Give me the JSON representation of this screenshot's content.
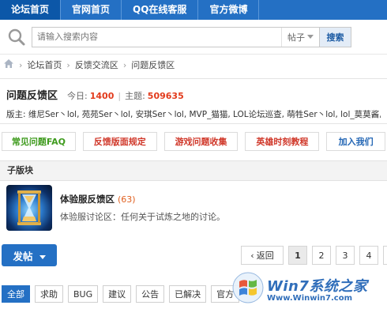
{
  "topnav": {
    "items": [
      "论坛首页",
      "官网首页",
      "QQ在线客服",
      "官方微博"
    ]
  },
  "search": {
    "placeholder": "请输入搜索内容",
    "scope": "帖子",
    "button": "搜索"
  },
  "breadcrumb": {
    "items": [
      "论坛首页",
      "反馈交流区",
      "问题反馈区"
    ]
  },
  "forum": {
    "title": "问题反馈区",
    "today_label": "今日:",
    "today_value": "1400",
    "topics_label": "主题:",
    "topics_value": "509635",
    "moderators": "版主: 维尼Ser丶lol, 苑苑Ser丶lol, 安琪Ser丶lol, MVP_猫猫, LOL论坛巡查, 萌牲Ser丶lol, lol_莫莫酱, 陌"
  },
  "quick_buttons": [
    "常见问题FAQ",
    "反馈版面规定",
    "游戏问题收集",
    "英雄时刻教程",
    "加入我们"
  ],
  "subforum": {
    "header": "子版块",
    "name": "体验服反馈区",
    "count": "(63)",
    "desc": "体验服讨论区：任何关于试炼之地的讨论。"
  },
  "post_button": "发帖",
  "pager": {
    "prev": "返回",
    "pages": [
      "1",
      "2",
      "3",
      "4",
      "5"
    ],
    "current": "1"
  },
  "filters": [
    "全部",
    "求助",
    "BUG",
    "建议",
    "公告",
    "已解决",
    "官方"
  ],
  "watermark": {
    "main": "Win7系统之家",
    "url": "Www.Winwin7.com"
  },
  "colors": {
    "brand": "#2470c4",
    "highlight": "#e23a1b",
    "green": "#3f9b1e",
    "red": "#d0382a"
  }
}
